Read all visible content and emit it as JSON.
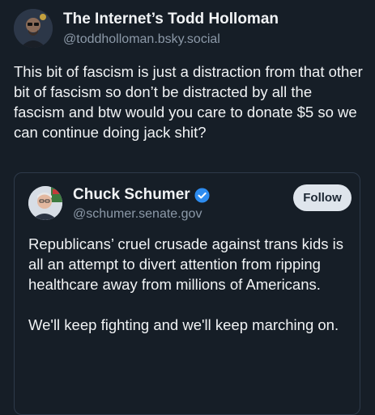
{
  "post": {
    "author_name": "The Internet’s Todd Holloman",
    "author_handle": "@toddholloman.bsky.social",
    "text": "This bit of fascism is just a distraction from that other bit of fascism so don’t be distracted by all the fascism and btw would you care to donate $5 so we can continue doing jack shit?"
  },
  "quote": {
    "author_name": "Chuck Schumer",
    "author_handle": "@schumer.senate.gov",
    "verified": true,
    "follow_label": "Follow",
    "paragraphs": [
      "Republicans’ cruel crusade against trans kids is all an attempt to divert attention from ripping healthcare away from millions of Americans.",
      "We'll keep fighting and we'll keep marching on."
    ]
  },
  "colors": {
    "background": "#161e27",
    "verified_badge": "#2d8cf0",
    "follow_button_bg": "#dfe5ec"
  }
}
